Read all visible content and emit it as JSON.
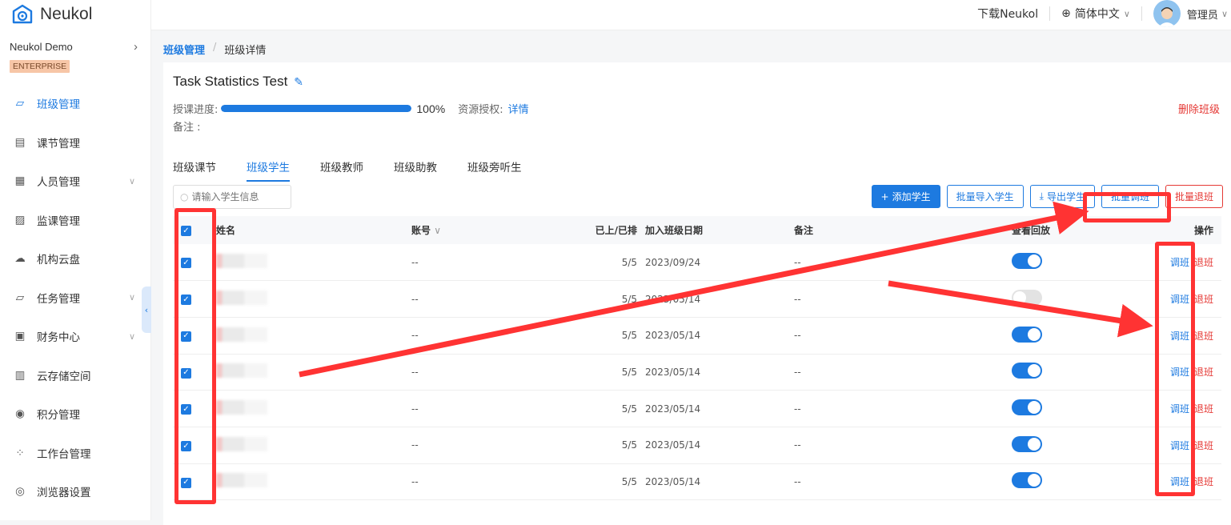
{
  "app": {
    "name": "Neukol"
  },
  "org": {
    "name": "Neukol Demo",
    "badge": "ENTERPRISE"
  },
  "menu": [
    {
      "label": "班级管理",
      "icon": "class-icon",
      "active": true
    },
    {
      "label": "课节管理",
      "icon": "lesson-icon"
    },
    {
      "label": "人员管理",
      "icon": "people-icon",
      "expand": true
    },
    {
      "label": "监课管理",
      "icon": "monitor-icon"
    },
    {
      "label": "机构云盘",
      "icon": "cloud-icon"
    },
    {
      "label": "任务管理",
      "icon": "task-icon",
      "expand": true
    },
    {
      "label": "财务中心",
      "icon": "finance-icon",
      "expand": true
    },
    {
      "label": "云存储空间",
      "icon": "storage-icon"
    },
    {
      "label": "积分管理",
      "icon": "points-icon"
    },
    {
      "label": "工作台管理",
      "icon": "workbench-icon"
    },
    {
      "label": "浏览器设置",
      "icon": "browser-icon"
    }
  ],
  "topbar": {
    "download": "下载Neukol",
    "language": "简体中文",
    "user": "管理员"
  },
  "breadcrumb": {
    "root": "班级管理",
    "current": "班级详情"
  },
  "header": {
    "title": "Task Statistics Test",
    "progress_label": "授课进度:",
    "progress_value": "100%",
    "progress_fraction": 1.0,
    "resource_label": "资源授权:",
    "resource_link": "详情",
    "note_label": "备注 :",
    "delete": "删除班级"
  },
  "tabs": [
    "班级课节",
    "班级学生",
    "班级教师",
    "班级助教",
    "班级旁听生"
  ],
  "active_tab": 1,
  "search": {
    "placeholder": "请输入学生信息"
  },
  "actions": {
    "add": "添加学生",
    "import": "批量导入学生",
    "export": "导出学生",
    "transfer": "批量调班",
    "withdraw": "批量退班"
  },
  "table": {
    "headers": {
      "name": "姓名",
      "account": "账号",
      "lessons": "已上/已排",
      "join_date": "加入班级日期",
      "note": "备注",
      "playback": "查看回放",
      "ops": "操作"
    },
    "rows": [
      {
        "account": "--",
        "lessons": "5/5",
        "date": "2023/09/24",
        "note": "--",
        "playback": true
      },
      {
        "account": "--",
        "lessons": "5/5",
        "date": "2023/05/14",
        "note": "--",
        "playback": false
      },
      {
        "account": "--",
        "lessons": "5/5",
        "date": "2023/05/14",
        "note": "--",
        "playback": true
      },
      {
        "account": "--",
        "lessons": "5/5",
        "date": "2023/05/14",
        "note": "--",
        "playback": true
      },
      {
        "account": "--",
        "lessons": "5/5",
        "date": "2023/05/14",
        "note": "--",
        "playback": true
      },
      {
        "account": "--",
        "lessons": "5/5",
        "date": "2023/05/14",
        "note": "--",
        "playback": true
      },
      {
        "account": "--",
        "lessons": "5/5",
        "date": "2023/05/14",
        "note": "--",
        "playback": true
      }
    ],
    "op_transfer": "调班",
    "op_withdraw": "退班"
  }
}
